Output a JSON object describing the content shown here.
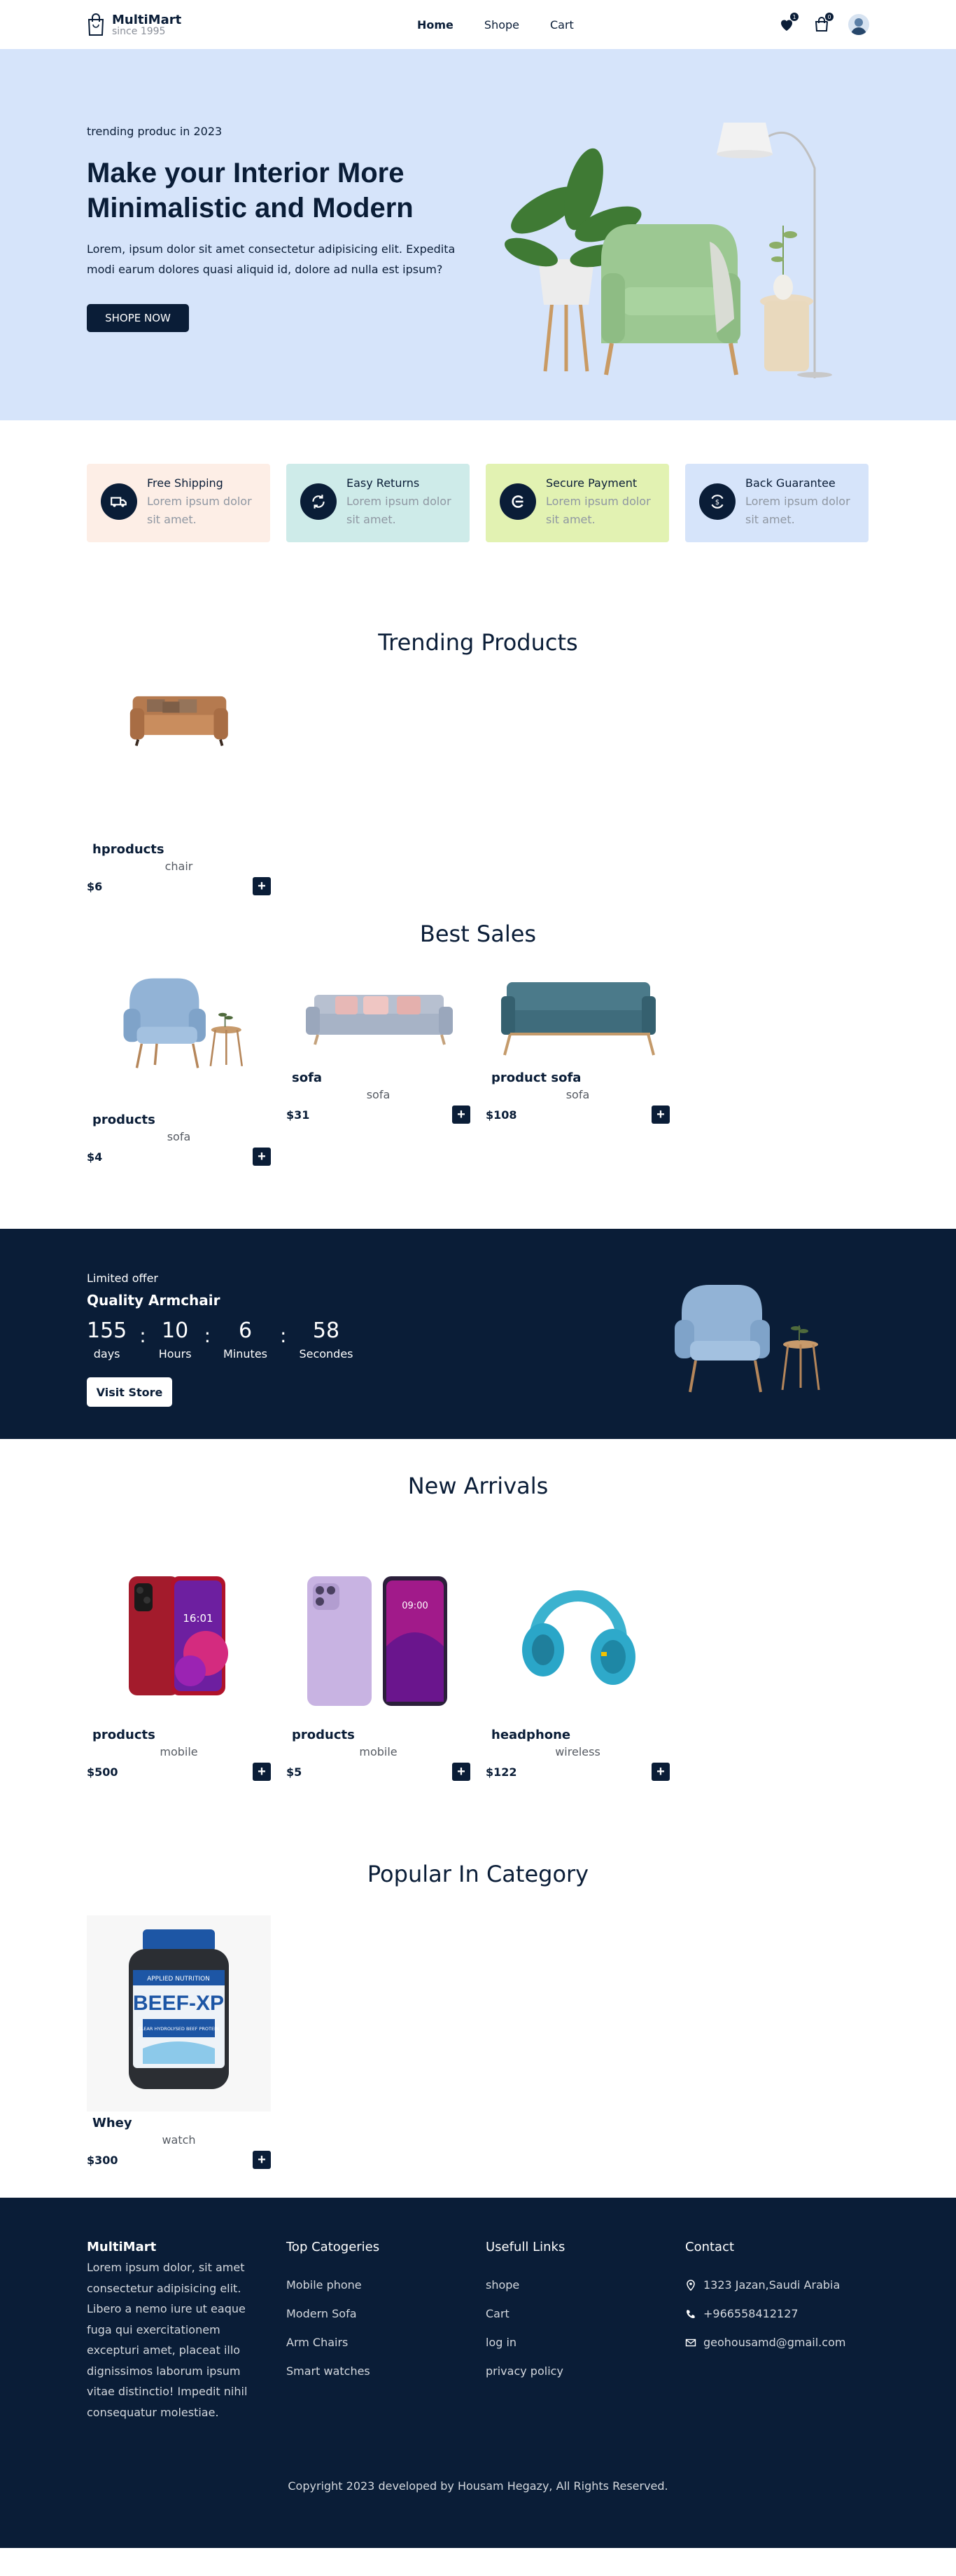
{
  "header": {
    "brand": "MultiMart",
    "since": "since 1995",
    "nav": [
      "Home",
      "Shope",
      "Cart"
    ],
    "wishlist_count": "1",
    "cart_count": "0",
    "icons": [
      "heart-icon",
      "bag-icon",
      "avatar"
    ]
  },
  "hero": {
    "subtitle": "trending produc in 2023",
    "title": "Make your Interior More Minimalistic and Modern",
    "text": "Lorem, ipsum dolor sit amet consectetur adipisicing elit. Expedita modi earum dolores quasi aliquid id, dolore ad nulla est ipsum?",
    "button": "SHOPE NOW"
  },
  "services": [
    {
      "title": "Free Shipping",
      "text": "Lorem ipsum dolor sit amet.",
      "bg": "#fdeee6",
      "icon": "truck-icon"
    },
    {
      "title": "Easy Returns",
      "text": "Lorem ipsum dolor sit amet.",
      "bg": "#ceebe9",
      "icon": "refresh-icon"
    },
    {
      "title": "Secure Payment",
      "text": "Lorem ipsum dolor sit amet.",
      "bg": "#e2f2b2",
      "icon": "payment-icon"
    },
    {
      "title": "Back Guarantee",
      "text": "Lorem ipsum dolor sit amet.",
      "bg": "#d6e4fa",
      "icon": "guarantee-icon"
    }
  ],
  "trending": {
    "title": "Trending Products",
    "items": [
      {
        "name": "hproducts",
        "category": "chair",
        "price": "$6"
      }
    ]
  },
  "best": {
    "title": "Best Sales",
    "items": [
      {
        "name": "products",
        "category": "sofa",
        "price": "$4"
      },
      {
        "name": "sofa",
        "category": "sofa",
        "price": "$31"
      },
      {
        "name": "product sofa",
        "category": "sofa",
        "price": "$108"
      }
    ]
  },
  "offer": {
    "label": "Limited offer",
    "product": "Quality Armchair",
    "days": "155",
    "days_label": "days",
    "hours": "10",
    "hours_label": "Hours",
    "minutes": "6",
    "minutes_label": "Minutes",
    "seconds": "58",
    "seconds_label": "Secondes",
    "separator": ":",
    "button": "Visit Store"
  },
  "arrivals": {
    "title": "New Arrivals",
    "items": [
      {
        "name": "products",
        "category": "mobile",
        "price": "$500"
      },
      {
        "name": "products",
        "category": "mobile",
        "price": "$5"
      },
      {
        "name": "headphone",
        "category": "wireless",
        "price": "$122"
      }
    ]
  },
  "popular": {
    "title": "Popular In Category",
    "items": [
      {
        "name": "Whey",
        "category": "watch",
        "price": "$300"
      }
    ],
    "jar_brand": "APPLIED NUTRITION",
    "jar_title": "BEEF-XP",
    "jar_sub": "CLEAR HYDROLYSED BEEF PROTEIN"
  },
  "phone_time": "16:01",
  "phone_time2": "09:00",
  "add_symbol": "+",
  "footer": {
    "brand": "MultiMart",
    "about": "Lorem ipsum dolor, sit amet consectetur adipisicing elit. Libero a nemo iure ut eaque fuga qui exercitationem excepturi amet, placeat illo dignissimos laborum ipsum vitae distinctio! Impedit nihil consequatur molestiae.",
    "categories_title": "Top Catogeries",
    "categories": [
      "Mobile phone",
      "Modern Sofa",
      "Arm Chairs",
      "Smart watches"
    ],
    "links_title": "Usefull Links",
    "links": [
      "shope",
      "Cart",
      "log in",
      "privacy policy"
    ],
    "contact_title": "Contact",
    "address": "1323 Jazan,Saudi Arabia",
    "phone": "+966558412127",
    "email": "geohousamd@gmail.com",
    "copyright": "Copyright 2023 developed by Housam Hegazy, All Rights Reserved."
  },
  "colors": {
    "primary": "#0a1d37",
    "hero_bg": "#d6e4fa"
  }
}
